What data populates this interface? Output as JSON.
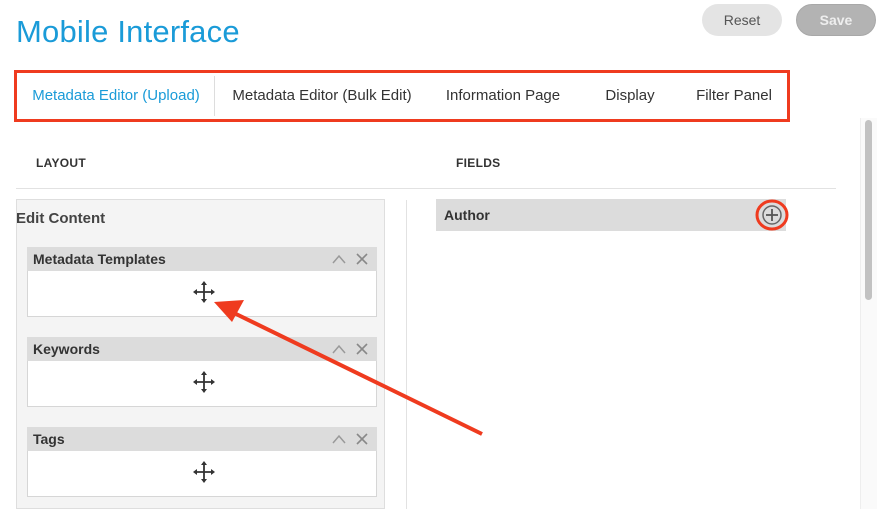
{
  "app": {
    "title": "Mobile Interface"
  },
  "actions": {
    "reset_label": "Reset",
    "save_label": "Save"
  },
  "tabs": [
    {
      "label": "Metadata Editor (Upload)",
      "active": true
    },
    {
      "label": "Metadata Editor (Bulk Edit)",
      "active": false
    },
    {
      "label": "Information Page",
      "active": false
    },
    {
      "label": "Display",
      "active": false
    },
    {
      "label": "Filter Panel",
      "active": false
    }
  ],
  "layout": {
    "heading": "LAYOUT",
    "panel_title": "Edit Content",
    "blocks": [
      {
        "label": "Metadata Templates"
      },
      {
        "label": "Keywords"
      },
      {
        "label": "Tags"
      }
    ]
  },
  "fields": {
    "heading": "FIELDS",
    "items": [
      {
        "label": "Author"
      }
    ]
  },
  "colors": {
    "accent": "#1a9bd8",
    "annotation": "#ef3b1f"
  },
  "icons": {
    "move": "move-icon",
    "collapse": "chevron-up-icon",
    "close": "close-icon",
    "add": "plus-circle-icon"
  }
}
